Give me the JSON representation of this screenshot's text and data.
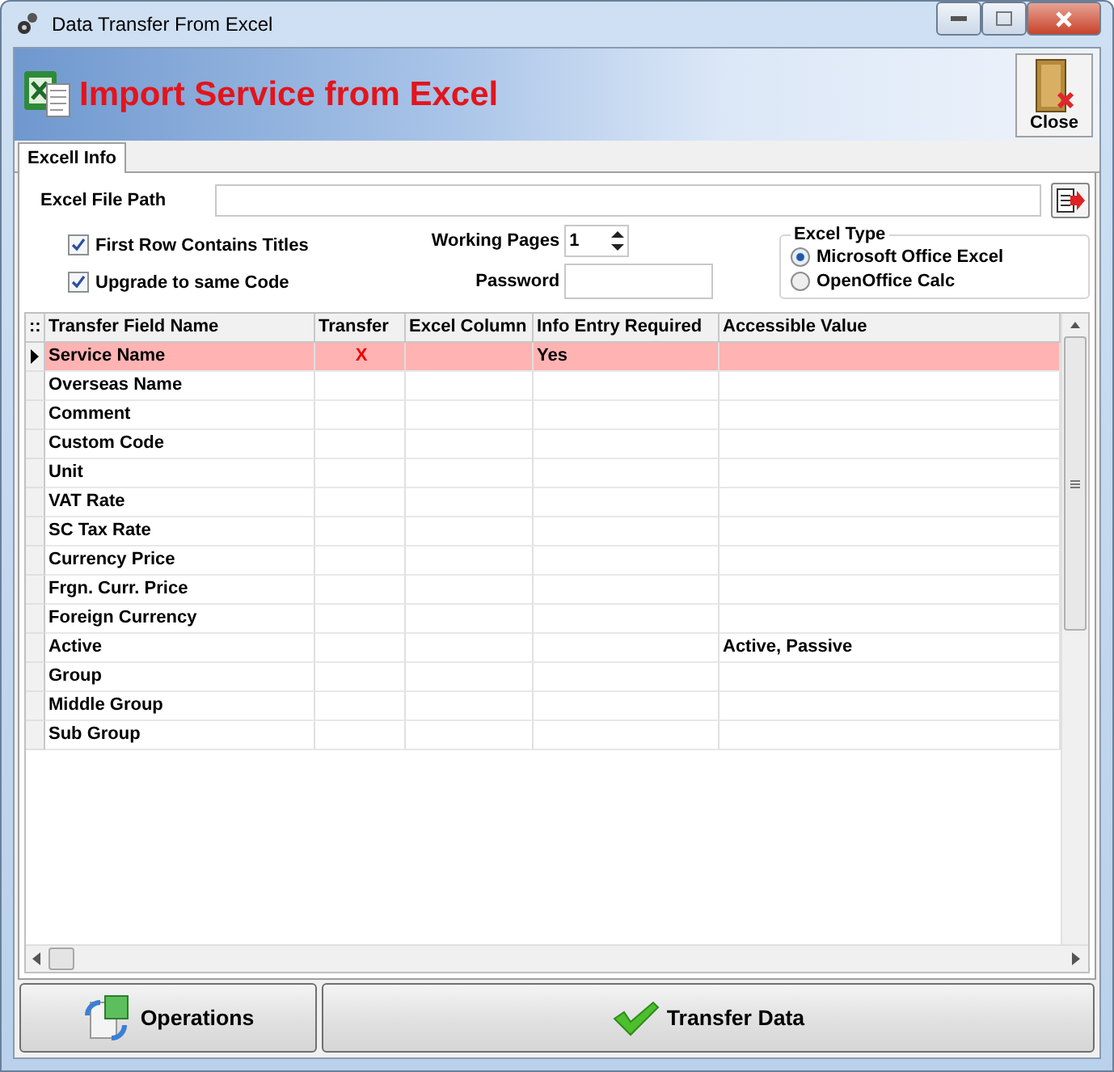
{
  "window": {
    "title": "Data Transfer From Excel"
  },
  "header": {
    "title": "Import Service from Excel",
    "close_label": "Close"
  },
  "tabs": [
    {
      "label": "Excell Info",
      "selected": true
    }
  ],
  "form": {
    "file_path_label": "Excel File Path",
    "first_row_titles": {
      "label": "First Row Contains Titles",
      "checked": true
    },
    "upgrade_same_code": {
      "label": "Upgrade to same Code",
      "checked": true
    },
    "working_pages_label": "Working Pages",
    "working_pages": "1",
    "password_label": "Password",
    "excel_type": {
      "title": "Excel Type",
      "options": [
        {
          "label": "Microsoft Office Excel",
          "selected": true
        },
        {
          "label": "OpenOffice Calc",
          "selected": false
        }
      ]
    }
  },
  "grid": {
    "corner": "::",
    "columns": [
      "Transfer Field Name",
      "Transfer",
      "Excel Column",
      "Info Entry Required",
      "Accessible Value"
    ],
    "rows": [
      {
        "cells": [
          "Service Name",
          "X",
          "",
          "Yes",
          ""
        ],
        "selected": true
      },
      {
        "cells": [
          "Overseas Name",
          "",
          "",
          "",
          ""
        ],
        "selected": false
      },
      {
        "cells": [
          "Comment",
          "",
          "",
          "",
          ""
        ],
        "selected": false
      },
      {
        "cells": [
          "Custom Code",
          "",
          "",
          "",
          ""
        ],
        "selected": false
      },
      {
        "cells": [
          "Unit",
          "",
          "",
          "",
          ""
        ],
        "selected": false
      },
      {
        "cells": [
          "VAT Rate",
          "",
          "",
          "",
          ""
        ],
        "selected": false
      },
      {
        "cells": [
          "SC Tax Rate",
          "",
          "",
          "",
          ""
        ],
        "selected": false
      },
      {
        "cells": [
          "Currency Price",
          "",
          "",
          "",
          ""
        ],
        "selected": false
      },
      {
        "cells": [
          "Frgn. Curr. Price",
          "",
          "",
          "",
          ""
        ],
        "selected": false
      },
      {
        "cells": [
          "Foreign Currency",
          "",
          "",
          "",
          ""
        ],
        "selected": false
      },
      {
        "cells": [
          "Active",
          "",
          "",
          "",
          "Active, Passive"
        ],
        "selected": false
      },
      {
        "cells": [
          "Group",
          "",
          "",
          "",
          ""
        ],
        "selected": false
      },
      {
        "cells": [
          "Middle Group",
          "",
          "",
          "",
          ""
        ],
        "selected": false
      },
      {
        "cells": [
          "Sub Group",
          "",
          "",
          "",
          ""
        ],
        "selected": false
      }
    ]
  },
  "buttons": [
    {
      "label": "Operations",
      "kind": "operations"
    },
    {
      "label": "Transfer Data",
      "kind": "transfer"
    }
  ]
}
